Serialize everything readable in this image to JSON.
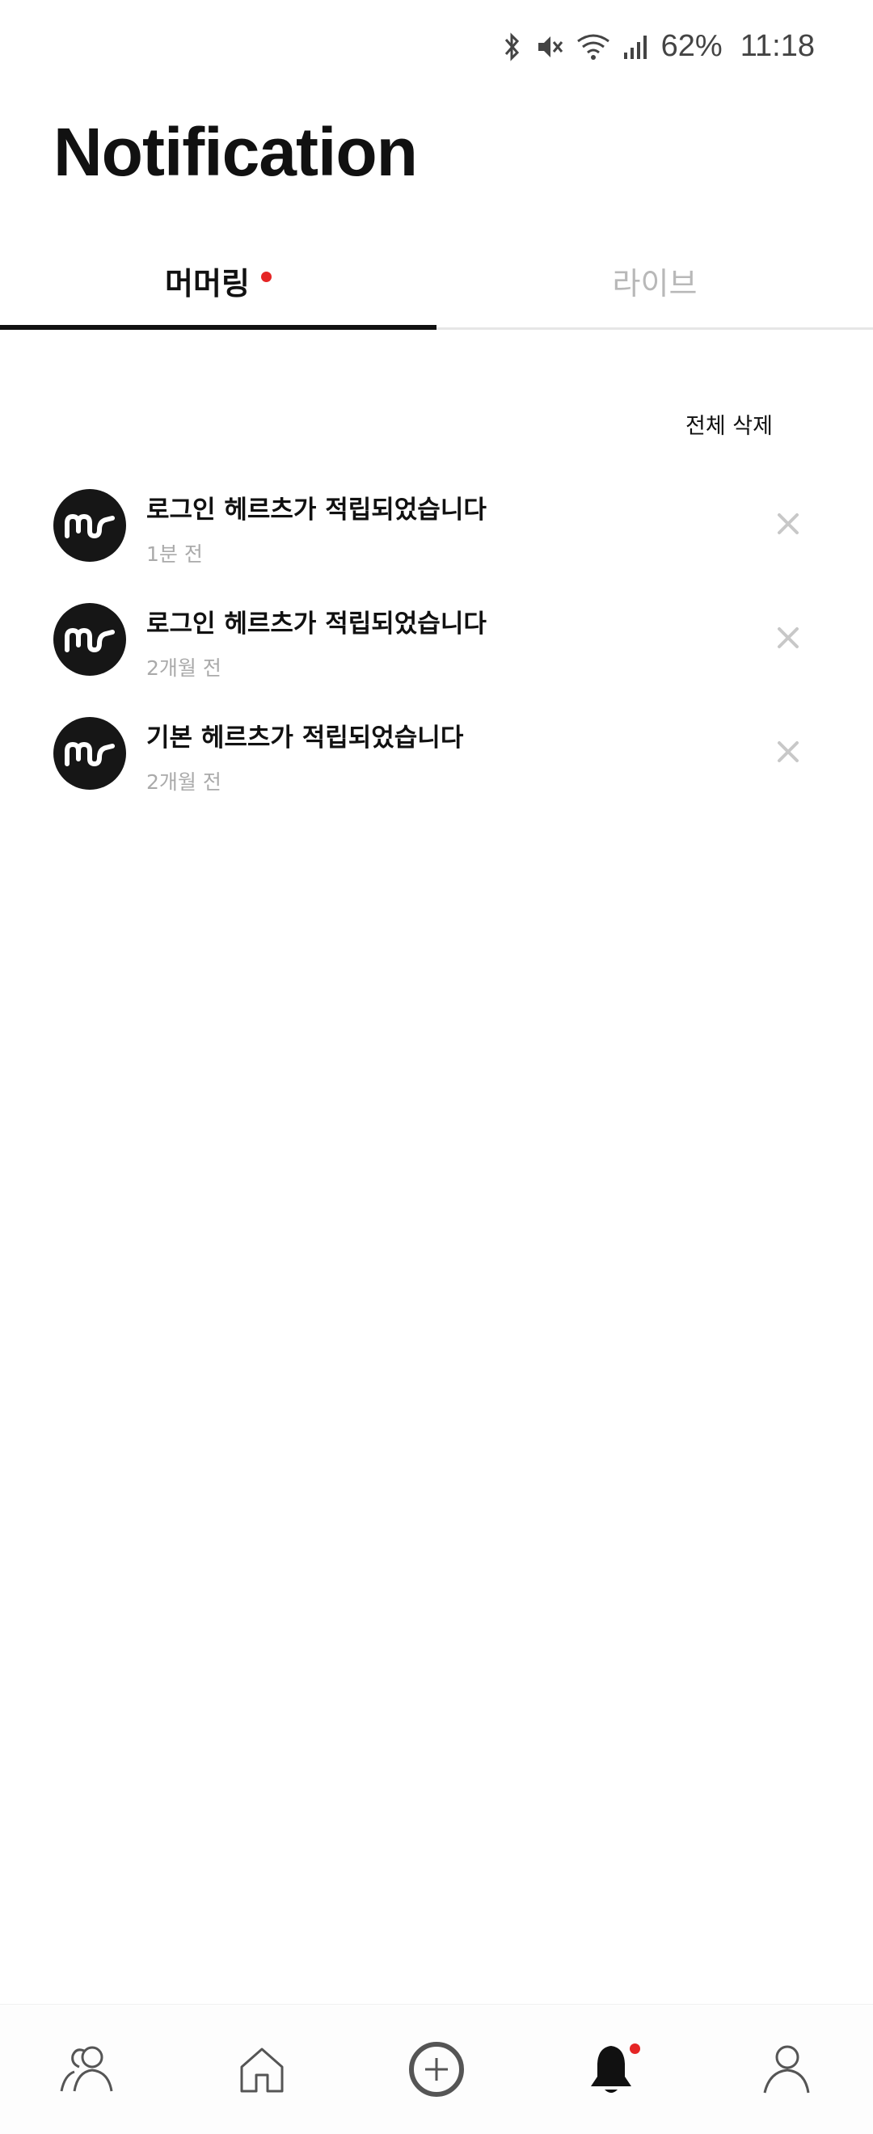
{
  "status_bar": {
    "icons": [
      "bluetooth-icon",
      "mute-icon",
      "wifi-icon",
      "signal-icon"
    ],
    "battery": "62%",
    "time": "11:18"
  },
  "page_title": "Notification",
  "tabs": [
    {
      "label": "머머링",
      "active": true,
      "has_dot": true
    },
    {
      "label": "라이브",
      "active": false,
      "has_dot": false
    }
  ],
  "delete_all_label": "전체 삭제",
  "notifications": [
    {
      "title": "로그인 헤르츠가 적립되었습니다",
      "time": "1분 전",
      "icon": "murmuring-logo-icon"
    },
    {
      "title": "로그인 헤르츠가 적립되었습니다",
      "time": "2개월 전",
      "icon": "murmuring-logo-icon"
    },
    {
      "title": "기본 헤르츠가 적립되었습니다",
      "time": "2개월 전",
      "icon": "murmuring-logo-icon"
    }
  ],
  "bottom_nav": [
    {
      "name": "friends",
      "icon": "people-icon",
      "active": false
    },
    {
      "name": "home",
      "icon": "home-icon",
      "active": false
    },
    {
      "name": "add",
      "icon": "plus-circle-icon",
      "active": false
    },
    {
      "name": "notifications",
      "icon": "bell-icon",
      "active": true,
      "has_dot": true
    },
    {
      "name": "profile",
      "icon": "person-icon",
      "active": false
    }
  ],
  "colors": {
    "accent_dot": "#e52525",
    "text_primary": "#111111",
    "text_secondary": "#aaaaaa",
    "inactive_tab": "#b8b8b8"
  }
}
